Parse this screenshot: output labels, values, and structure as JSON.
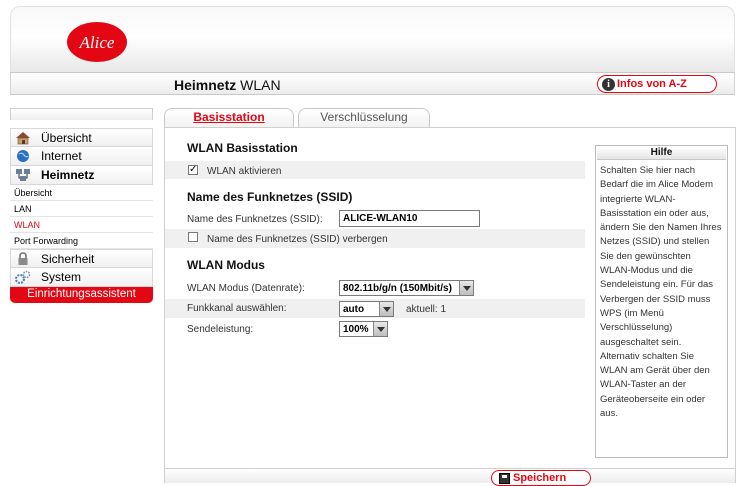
{
  "brand": {
    "logo_text": "Alice",
    "accent_color": "#e30613"
  },
  "header": {
    "title_bold": "Heimnetz",
    "title_rest": " WLAN",
    "info_button_label": "Infos von A-Z",
    "info_icon": "info-icon"
  },
  "sidebar": {
    "items": [
      {
        "label": "Übersicht",
        "icon": "home-icon"
      },
      {
        "label": "Internet",
        "icon": "globe-icon"
      },
      {
        "label": "Heimnetz",
        "icon": "network-icon"
      }
    ],
    "subitems": [
      {
        "label": "Übersicht"
      },
      {
        "label": "LAN"
      },
      {
        "label": "WLAN",
        "active": true
      },
      {
        "label": "Port Forwarding"
      }
    ],
    "items2": [
      {
        "label": "Sicherheit",
        "icon": "lock-icon"
      },
      {
        "label": "System",
        "icon": "gears-icon"
      }
    ],
    "wizard_label": "Einrichtungsassistent"
  },
  "tabs": [
    {
      "label": "Basisstation",
      "active": true
    },
    {
      "label": "Verschlüsselung",
      "active": false
    }
  ],
  "form": {
    "basis_title": "WLAN Basisstation",
    "wlan_enable_label": "WLAN aktivieren",
    "wlan_enabled": true,
    "ssid_title": "Name des Funknetzes (SSID)",
    "ssid_label": "Name des Funknetzes (SSID):",
    "ssid_value": "ALICE-WLAN10",
    "ssid_hide_label": "Name des Funknetzes (SSID) verbergen",
    "ssid_hidden": false,
    "mode_title": "WLAN Modus",
    "mode_label": "WLAN Modus (Datenrate):",
    "mode_value": "802.11b/g/n (150Mbit/s)",
    "channel_label": "Funkkanal auswählen:",
    "channel_value": "auto",
    "channel_current": "aktuell: 1",
    "power_label": "Sendeleistung:",
    "power_value": "100%"
  },
  "help": {
    "title": "Hilfe",
    "text": "Schalten Sie hier nach Bedarf die im Alice Modem integrierte WLAN-Basisstation ein oder aus, ändern Sie den Namen Ihres Netzes (SSID) und stellen Sie den gewünschten WLAN-Modus und die Sendeleistung ein. Für das Verbergen der SSID muss WPS (im Menü Verschlüsselung) ausgeschaltet sein. Alternativ schalten Sie WLAN am Gerät über den WLAN-Taster an der Geräteoberseite ein oder aus."
  },
  "footer": {
    "save_label": "Speichern",
    "save_icon": "floppy-disk-icon"
  }
}
